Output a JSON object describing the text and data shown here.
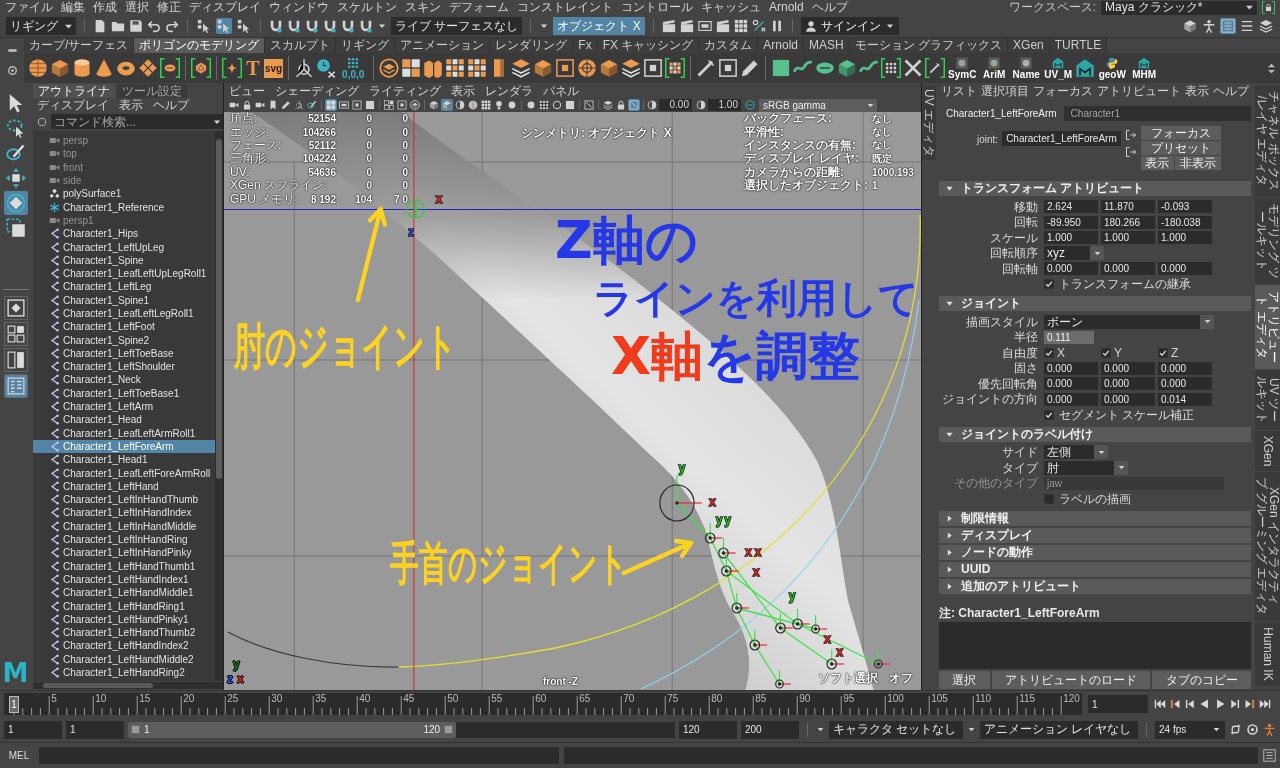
{
  "menu_bar": {
    "items": [
      "ファイル",
      "編集",
      "作成",
      "選択",
      "修正",
      "ディスプレイ",
      "ウィンドウ",
      "スケルトン",
      "スキン",
      "デフォーム",
      "コンストレイント",
      "コントロール",
      "キャッシュ",
      "Arnold",
      "ヘルプ"
    ],
    "workspace_label": "ワークスペース:",
    "workspace": "Maya クラシック*"
  },
  "status_line": {
    "menu_set": "リギング",
    "live_surface": "ライブ サーフェスなし",
    "symmetry": "オブジェクト X",
    "sign_in": "サインイン"
  },
  "shelf": {
    "tabs": [
      {
        "label": "カーブ/サーフェス",
        "selected": false
      },
      {
        "label": "ポリゴンのモデリング",
        "selected": true
      },
      {
        "label": "スカルプト",
        "selected": false
      },
      {
        "label": "リギング",
        "selected": false
      },
      {
        "label": "アニメーション",
        "selected": false
      },
      {
        "label": "レンダリング",
        "selected": false
      },
      {
        "label": "Fx",
        "selected": false
      },
      {
        "label": "FX キャッシング",
        "selected": false
      },
      {
        "label": "カスタム",
        "selected": false
      },
      {
        "label": "Arnold",
        "selected": false
      },
      {
        "label": "MASH",
        "selected": false
      },
      {
        "label": "モーション グラフィックス",
        "selected": false
      },
      {
        "label": "XGen",
        "selected": false
      },
      {
        "label": "TURTLE",
        "selected": false
      }
    ],
    "type_tool": "T",
    "icon_labels": [
      "svg",
      "0,0,0",
      "SymC",
      "AriM",
      "Name",
      "UV_M",
      "geoW",
      "MHM"
    ]
  },
  "toolbox": {
    "tools": [
      {
        "selected": false
      },
      {
        "selected": false
      },
      {
        "selected": false
      },
      {
        "selected": false
      },
      {
        "selected": true
      },
      {
        "selected": false
      }
    ],
    "layouts": [
      {
        "selected": false
      },
      {
        "selected": false
      },
      {
        "selected": false
      },
      {
        "selected": true
      }
    ],
    "logo": "M"
  },
  "outliner": {
    "tabs": [
      {
        "label": "アウトライナ",
        "selected": true
      },
      {
        "label": "ツール設定",
        "selected": false
      }
    ],
    "menu": [
      "ディスプレイ",
      "表示",
      "ヘルプ"
    ],
    "search": {
      "placeholder": "コマンド検索..."
    },
    "items": [
      {
        "label": "persp",
        "kind": "camera",
        "hidden": true,
        "selected": false
      },
      {
        "label": "top",
        "kind": "camera",
        "hidden": true,
        "selected": false
      },
      {
        "label": "front",
        "kind": "camera",
        "hidden": true,
        "selected": false
      },
      {
        "label": "side",
        "kind": "camera",
        "hidden": true,
        "selected": false
      },
      {
        "label": "polySurface1",
        "kind": "mesh",
        "hidden": false,
        "selected": false
      },
      {
        "label": "Character1_Reference",
        "kind": "reference",
        "hidden": false,
        "selected": false
      },
      {
        "label": "persp1",
        "kind": "camera",
        "hidden": true,
        "selected": false
      },
      {
        "label": "Character1_Hips",
        "kind": "joint",
        "hidden": false,
        "selected": false
      },
      {
        "label": "Character1_LeftUpLeg",
        "kind": "joint",
        "hidden": false,
        "selected": false
      },
      {
        "label": "Character1_Spine",
        "kind": "joint",
        "hidden": false,
        "selected": false
      },
      {
        "label": "Character1_LeafLeftUpLegRoll1",
        "kind": "joint",
        "hidden": false,
        "selected": false
      },
      {
        "label": "Character1_LeftLeg",
        "kind": "joint",
        "hidden": false,
        "selected": false
      },
      {
        "label": "Character1_Spine1",
        "kind": "joint",
        "hidden": false,
        "selected": false
      },
      {
        "label": "Character1_LeafLeftLegRoll1",
        "kind": "joint",
        "hidden": false,
        "selected": false
      },
      {
        "label": "Character1_LeftFoot",
        "kind": "joint",
        "hidden": false,
        "selected": false
      },
      {
        "label": "Character1_Spine2",
        "kind": "joint",
        "hidden": false,
        "selected": false
      },
      {
        "label": "Character1_LeftToeBase",
        "kind": "joint",
        "hidden": false,
        "selected": false
      },
      {
        "label": "Character1_LeftShoulder",
        "kind": "joint",
        "hidden": false,
        "selected": false
      },
      {
        "label": "Character1_Neck",
        "kind": "joint",
        "hidden": false,
        "selected": false
      },
      {
        "label": "Character1_LeftToeBase1",
        "kind": "joint",
        "hidden": false,
        "selected": false
      },
      {
        "label": "Character1_LeftArm",
        "kind": "joint",
        "hidden": false,
        "selected": false
      },
      {
        "label": "Character1_Head",
        "kind": "joint",
        "hidden": false,
        "selected": false
      },
      {
        "label": "Character1_LeafLeftArmRoll1",
        "kind": "joint",
        "hidden": false,
        "selected": false
      },
      {
        "label": "Character1_LeftForeArm",
        "kind": "joint",
        "hidden": false,
        "selected": true
      },
      {
        "label": "Character1_Head1",
        "kind": "joint",
        "hidden": false,
        "selected": false
      },
      {
        "label": "Character1_LeafLeftForeArmRoll",
        "kind": "joint",
        "hidden": false,
        "selected": false
      },
      {
        "label": "Character1_LeftHand",
        "kind": "joint",
        "hidden": false,
        "selected": false
      },
      {
        "label": "Character1_LeftInHandThumb",
        "kind": "joint",
        "hidden": false,
        "selected": false
      },
      {
        "label": "Character1_LeftInHandIndex",
        "kind": "joint",
        "hidden": false,
        "selected": false
      },
      {
        "label": "Character1_LeftInHandMiddle",
        "kind": "joint",
        "hidden": false,
        "selected": false
      },
      {
        "label": "Character1_LeftInHandRing",
        "kind": "joint",
        "hidden": false,
        "selected": false
      },
      {
        "label": "Character1_LeftInHandPinky",
        "kind": "joint",
        "hidden": false,
        "selected": false
      },
      {
        "label": "Character1_LeftHandThumb1",
        "kind": "joint",
        "hidden": false,
        "selected": false
      },
      {
        "label": "Character1_LeftHandIndex1",
        "kind": "joint",
        "hidden": false,
        "selected": false
      },
      {
        "label": "Character1_LeftHandMiddle1",
        "kind": "joint",
        "hidden": false,
        "selected": false
      },
      {
        "label": "Character1_LeftHandRing1",
        "kind": "joint",
        "hidden": false,
        "selected": false
      },
      {
        "label": "Character1_LeftHandPinky1",
        "kind": "joint",
        "hidden": false,
        "selected": false
      },
      {
        "label": "Character1_LeftHandThumb2",
        "kind": "joint",
        "hidden": false,
        "selected": false
      },
      {
        "label": "Character1_LeftHandIndex2",
        "kind": "joint",
        "hidden": false,
        "selected": false
      },
      {
        "label": "Character1_LeftHandMiddle2",
        "kind": "joint",
        "hidden": false,
        "selected": false
      },
      {
        "label": "Character1_LeftHandRing2",
        "kind": "joint",
        "hidden": false,
        "selected": false
      }
    ]
  },
  "viewport": {
    "menu": [
      "ビュー",
      "シェーディング",
      "ライティング",
      "表示",
      "レンダラ",
      "パネル"
    ],
    "exposure": "0.00",
    "gamma": "1.00",
    "color_space": "sRGB gamma",
    "hud_left": [
      {
        "label": "頂点:",
        "values": [
          "52154",
          "0",
          "0"
        ]
      },
      {
        "label": "エッジ:",
        "values": [
          "104266",
          "0",
          "0"
        ]
      },
      {
        "label": "フェース:",
        "values": [
          "52112",
          "0",
          "0"
        ]
      },
      {
        "label": "三角形:",
        "values": [
          "104224",
          "0",
          "0"
        ]
      },
      {
        "label": "UV:",
        "values": [
          "54636",
          "0",
          "0"
        ]
      },
      {
        "label": "XGen スプライン:",
        "values": [
          "0",
          "0"
        ]
      },
      {
        "label": "GPU メモリ:",
        "values": [
          "8 192",
          "104",
          "7 0"
        ]
      }
    ],
    "symmetry": "シンメトリ: オブジェクト X",
    "hud_right": [
      {
        "label": "バックフェース:",
        "value": "なし"
      },
      {
        "label": "平滑性:",
        "value": "なし"
      },
      {
        "label": "インスタンスの有無:",
        "value": "なし"
      },
      {
        "label": "ディスプレイ レイヤ:",
        "value": "既定"
      },
      {
        "label": "カメラからの距離:",
        "value": "1000.193"
      },
      {
        "label": "選択したオブジェクト:",
        "value": "1"
      }
    ],
    "axis_labels": [
      {
        "text": "x",
        "color": "#e02828"
      },
      {
        "text": "z",
        "color": "#2848e0"
      },
      {
        "text": "y",
        "color": "#22c022"
      },
      {
        "text": "x",
        "color": "#e02828"
      },
      {
        "text": "y",
        "color": "#22c022"
      },
      {
        "text": "y",
        "color": "#22c022"
      },
      {
        "text": "x",
        "color": "#e02828"
      },
      {
        "text": "x",
        "color": "#e02828"
      },
      {
        "text": "x",
        "color": "#e02828"
      },
      {
        "text": "y",
        "color": "#22c022"
      },
      {
        "text": "x",
        "color": "#e02828"
      },
      {
        "text": "x",
        "color": "#e02828"
      }
    ],
    "view_axes": [
      {
        "text": "y",
        "color": "#0f800f"
      },
      {
        "text": "z",
        "color": "#3050ff"
      },
      {
        "text": "x",
        "color": "#e02828"
      }
    ],
    "camera": "front -Z",
    "soft_select": "ソフト選択",
    "corner": "オフ",
    "annotations": [
      {
        "kind": "pointer",
        "text": "肘のジョイント",
        "color": "#ffd31f"
      },
      {
        "kind": "note",
        "lines": [
          {
            "segments": [
              {
                "text": "Z軸の",
                "color": "#2438e8"
              }
            ]
          },
          {
            "segments": [
              {
                "text": "ラインを利用して",
                "color": "#2438e8"
              }
            ]
          },
          {
            "segments": [
              {
                "text": "X軸",
                "color": "#f23a1c"
              },
              {
                "text": "を調整",
                "color": "#2438e8"
              }
            ]
          }
        ]
      },
      {
        "kind": "pointer",
        "text": "手首のジョイント",
        "color": "#ffd31f"
      }
    ]
  },
  "uv_tab": {
    "label": "UV エディタ",
    "selected": false
  },
  "attribute_editor": {
    "menu": [
      "リスト",
      "選択項目",
      "フォーカス",
      "アトリビュート",
      "表示",
      "ヘルプ"
    ],
    "tabs": [
      {
        "label": "Character1_LeftForeArm",
        "selected": true
      },
      {
        "label": "Character1",
        "selected": false
      }
    ],
    "node_type": "joint:",
    "node_name": "Character1_LeftForeArm",
    "buttons": [
      "フォーカス",
      "プリセット",
      "表示",
      "非表示"
    ],
    "sections": [
      {
        "title": "トランスフォーム アトリビュート",
        "expanded": true,
        "rows": [
          {
            "kind": "vector",
            "label": "移動",
            "values": [
              "2.624",
              "11.870",
              "-0.093"
            ]
          },
          {
            "kind": "vector",
            "label": "回転",
            "values": [
              "-89.950",
              "180.266",
              "-180.038"
            ]
          },
          {
            "kind": "vector",
            "label": "スケール",
            "values": [
              "1.000",
              "1.000",
              "1.000"
            ]
          },
          {
            "kind": "dropdown",
            "label": "回転順序",
            "value": "xyz"
          },
          {
            "kind": "vector",
            "label": "回転軸",
            "values": [
              "0.000",
              "0.000",
              "0.000"
            ]
          },
          {
            "kind": "checkbox",
            "label": "トランスフォームの継承",
            "checked": true
          }
        ]
      },
      {
        "title": "ジョイント",
        "expanded": true,
        "rows": [
          {
            "kind": "dropdown",
            "label": "描画スタイル",
            "value": "ボーン"
          },
          {
            "kind": "number",
            "label": "半径",
            "value": "0.111"
          },
          {
            "kind": "checkgroup",
            "label": "自由度",
            "options": [
              {
                "label": "X",
                "checked": true
              },
              {
                "label": "Y",
                "checked": true
              },
              {
                "label": "Z",
                "checked": true
              }
            ]
          },
          {
            "kind": "vector",
            "label": "固さ",
            "values": [
              "0.000",
              "0.000",
              "0.000"
            ]
          },
          {
            "kind": "vector",
            "label": "優先回転角",
            "values": [
              "0.000",
              "0.000",
              "0.000"
            ]
          },
          {
            "kind": "vector",
            "label": "ジョイントの方向",
            "values": [
              "0.000",
              "0.000",
              "0.014"
            ]
          },
          {
            "kind": "checkbox",
            "label": "セグメント スケール補正",
            "checked": true
          }
        ]
      },
      {
        "title": "ジョイントのラベル付け",
        "expanded": true,
        "rows": [
          {
            "kind": "dropdown",
            "label": "サイド",
            "value": "左側"
          },
          {
            "kind": "dropdown",
            "label": "タイプ",
            "value": "肘"
          },
          {
            "kind": "text",
            "label": "その他のタイプ",
            "value": "jaw",
            "disabled": true
          },
          {
            "kind": "checkbox",
            "label": "ラベルの描画",
            "checked": false
          }
        ]
      },
      {
        "title": "制限情報",
        "expanded": false
      },
      {
        "title": "ディスプレイ",
        "expanded": false
      },
      {
        "title": "ノードの動作",
        "expanded": false
      },
      {
        "title": "UUID",
        "expanded": false
      },
      {
        "title": "追加のアトリビュート",
        "expanded": false
      }
    ],
    "notes_label": "注: Character1_LeftForeArm",
    "footer_buttons": [
      "選択",
      "アトリビュートのロード",
      "タブのコピー"
    ]
  },
  "side_tabs": [
    {
      "label": "チャネル ボックス/レイヤ エディタ",
      "selected": false
    },
    {
      "label": "モデリング ツールキット",
      "selected": false
    },
    {
      "label": "アトリビュート エディタ",
      "selected": true
    },
    {
      "label": "UV ツールキット",
      "selected": false
    },
    {
      "label": "XGen",
      "selected": false
    },
    {
      "label": "XGen インタラクティブ グルーミング エディタ",
      "selected": false
    },
    {
      "label": "Human IK",
      "selected": false
    }
  ],
  "time_slider": {
    "current_frame": "1",
    "level": 0,
    "ticks": [
      "5",
      "10",
      "15",
      "20",
      "25",
      "30",
      "35",
      "40",
      "45",
      "50",
      "55",
      "60",
      "65",
      "70",
      "75",
      "80",
      "85",
      "90",
      "95",
      "100",
      "105",
      "110",
      "115",
      "120"
    ],
    "current_time": "1"
  },
  "range_slider": {
    "start": "1",
    "playback_start": "1",
    "range_start": "1",
    "range_end": "120",
    "level": 0.6,
    "playback_end": "120",
    "end": "200",
    "character_set": "キャラクタ セットなし",
    "anim_layer": "アニメーション レイヤなし",
    "fps": "24 fps"
  },
  "command_line": {
    "language": "MEL"
  }
}
